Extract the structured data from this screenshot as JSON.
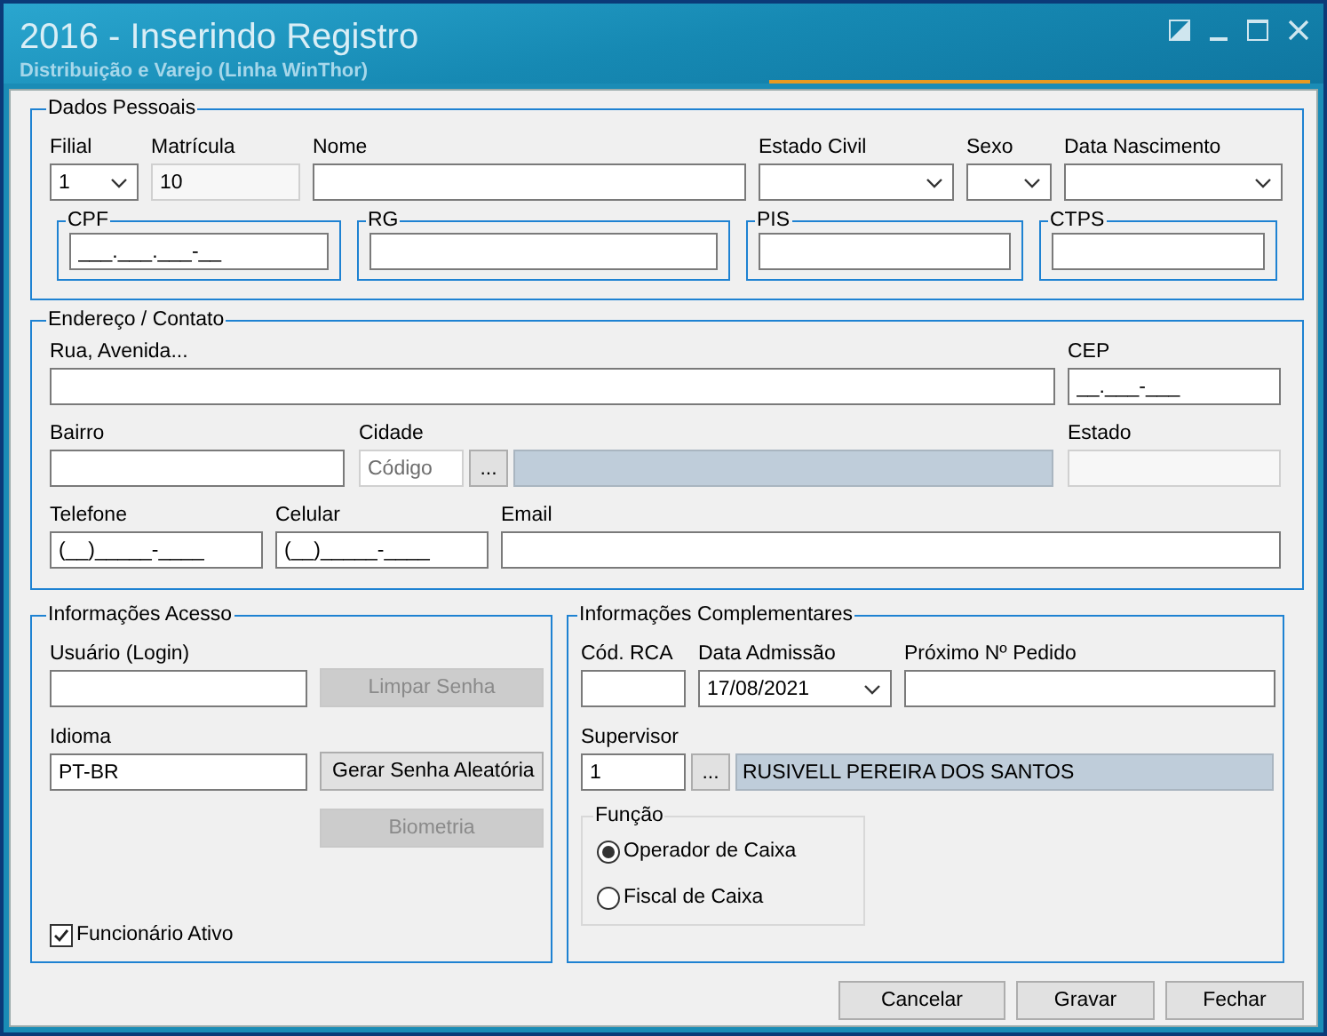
{
  "window": {
    "title": "2016 - Inserindo Registro",
    "subtitle": "Distribuição e Varejo (Linha WinThor)"
  },
  "personal": {
    "legend": "Dados Pessoais",
    "fields": [
      {
        "label": "Filial",
        "kind": "select",
        "value": "1"
      },
      {
        "label": "Matrícula",
        "kind": "readonly",
        "value": "10"
      },
      {
        "label": "Nome",
        "kind": "text"
      },
      {
        "label": "Estado Civil",
        "kind": "select"
      },
      {
        "label": "Sexo",
        "kind": "select"
      },
      {
        "label": "Data Nascimento",
        "kind": "select"
      }
    ],
    "documents": [
      {
        "legend": "CPF",
        "value": "___.___.___-__"
      },
      {
        "legend": "RG"
      },
      {
        "legend": "PIS"
      },
      {
        "legend": "CTPS"
      }
    ]
  },
  "address": {
    "legend": "Endereço / Contato",
    "rows": [
      [
        {
          "label": "Rua, Avenida...",
          "kind": "text"
        },
        {
          "label": "CEP",
          "kind": "text",
          "value": "__.___-___"
        }
      ],
      [
        {
          "label": "Bairro",
          "kind": "text"
        },
        {
          "label": "Cidade",
          "kind": "lookup",
          "code": {
            "placeholder": "Código"
          },
          "button": "..."
        },
        {
          "label": "Estado",
          "kind": "readonly"
        }
      ],
      [
        {
          "label": "Telefone",
          "kind": "text",
          "value": "(__)_____-____"
        },
        {
          "label": "Celular",
          "kind": "text",
          "value": "(__)_____-____"
        },
        {
          "label": "Email",
          "kind": "text"
        }
      ]
    ]
  },
  "access": {
    "legend": "Informações Acesso",
    "fields": [
      {
        "label": "Usuário (Login)",
        "kind": "text"
      },
      {
        "label": "Idioma",
        "kind": "text",
        "value": "PT-BR"
      }
    ],
    "buttons": [
      {
        "label": "Limpar Senha",
        "disabled": true
      },
      {
        "label": "Gerar Senha Aleatória",
        "disabled": false
      },
      {
        "label": "Biometria",
        "disabled": true
      }
    ],
    "active": {
      "label": "Funcionário Ativo",
      "checked": true
    }
  },
  "extra": {
    "legend": "Informações Complementares",
    "fields": [
      {
        "label": "Cód. RCA",
        "kind": "text"
      },
      {
        "label": "Data Admissão",
        "kind": "select",
        "value": "17/08/2021"
      },
      {
        "label": "Próximo Nº Pedido",
        "kind": "text"
      }
    ],
    "supervisor": {
      "label": "Supervisor",
      "kind": "lookup",
      "code": {
        "value": "1"
      },
      "button": "...",
      "name": "RUSIVELL PEREIRA DOS SANTOS"
    },
    "role": {
      "legend": "Função",
      "options": [
        {
          "label": "Operador de Caixa",
          "selected": true
        },
        {
          "label": "Fiscal de Caixa",
          "selected": false
        }
      ]
    }
  },
  "buttons": [
    "Cancelar",
    "Gravar",
    "Fechar"
  ]
}
